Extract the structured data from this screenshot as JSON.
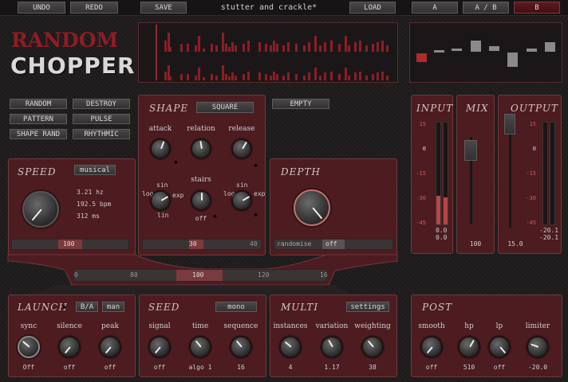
{
  "topbar": {
    "undo": "UNDO",
    "redo": "REDO",
    "save": "SAVE",
    "preset": "stutter and crackle*",
    "load": "LOAD",
    "a": "A",
    "ab": "A / B",
    "b": "B"
  },
  "logo": {
    "line1": "RANDOM",
    "line2": "CHOPPER"
  },
  "presets": [
    "RANDOM",
    "DESTROY",
    "PATTERN",
    "PULSE",
    "SHAPE RAND",
    "RHYTHMIC"
  ],
  "shape": {
    "title": "SHAPE",
    "mode": "SQUARE",
    "empty": "EMPTY",
    "attack": "attack",
    "relation": "relation",
    "release": "release",
    "stairs": "stairs",
    "sin1": "sin",
    "log1": "log",
    "lin1": "lin",
    "exp1": "exp",
    "sin2": "sin",
    "log2": "log",
    "exp2": "exp",
    "stairs_val": "off",
    "slider_val": "30",
    "slider_max": "40"
  },
  "speed": {
    "title": "SPEED",
    "mode": "musical",
    "hz": "3.21 hz",
    "bpm": "192.5 bpm",
    "ms": "312 ms",
    "slider": "100"
  },
  "depth": {
    "title": "DEPTH",
    "randomise": "randomise",
    "randomise_val": "off"
  },
  "center_slider": {
    "value": "100",
    "ticks": [
      "0",
      "80",
      "120",
      "16"
    ]
  },
  "meters": {
    "input": "INPUT",
    "mix": "MIX",
    "output": "OUTPUT",
    "scale": [
      "15",
      "0",
      "-15",
      "-30",
      "-45"
    ],
    "in_l": "0.0",
    "in_r": "0.0",
    "mix_val": "100",
    "out_val": "15.0",
    "out_l": "-20.1",
    "out_r": "-20.1"
  },
  "launch": {
    "title": "LAUNCH",
    "ba": "B/A",
    "man": "man",
    "sync": "sync",
    "silence": "silence",
    "peak": "peak",
    "sync_val": "Off",
    "silence_val": "off",
    "peak_val": "off"
  },
  "seed": {
    "title": "SEED",
    "mode": "mono",
    "signal": "signal",
    "time": "time",
    "sequence": "sequence",
    "signal_val": "off",
    "time_val": "algo 1",
    "sequence_val": "16"
  },
  "multi": {
    "title": "MULTI",
    "settings": "settings",
    "instances": "instances",
    "variation": "variation",
    "weighting": "weighting",
    "instances_val": "4",
    "variation_val": "1.17",
    "weighting_val": "38"
  },
  "post": {
    "title": "POST",
    "smooth": "smooth",
    "hp": "hp",
    "lp": "lp",
    "limiter": "limiter",
    "smooth_val": "off",
    "hp_val": "510",
    "lp_val": "off",
    "limiter_val": "-20.0"
  },
  "colors": {
    "panel": "#4c1c20",
    "accent": "#8e1d24",
    "meter": "#b84545"
  }
}
